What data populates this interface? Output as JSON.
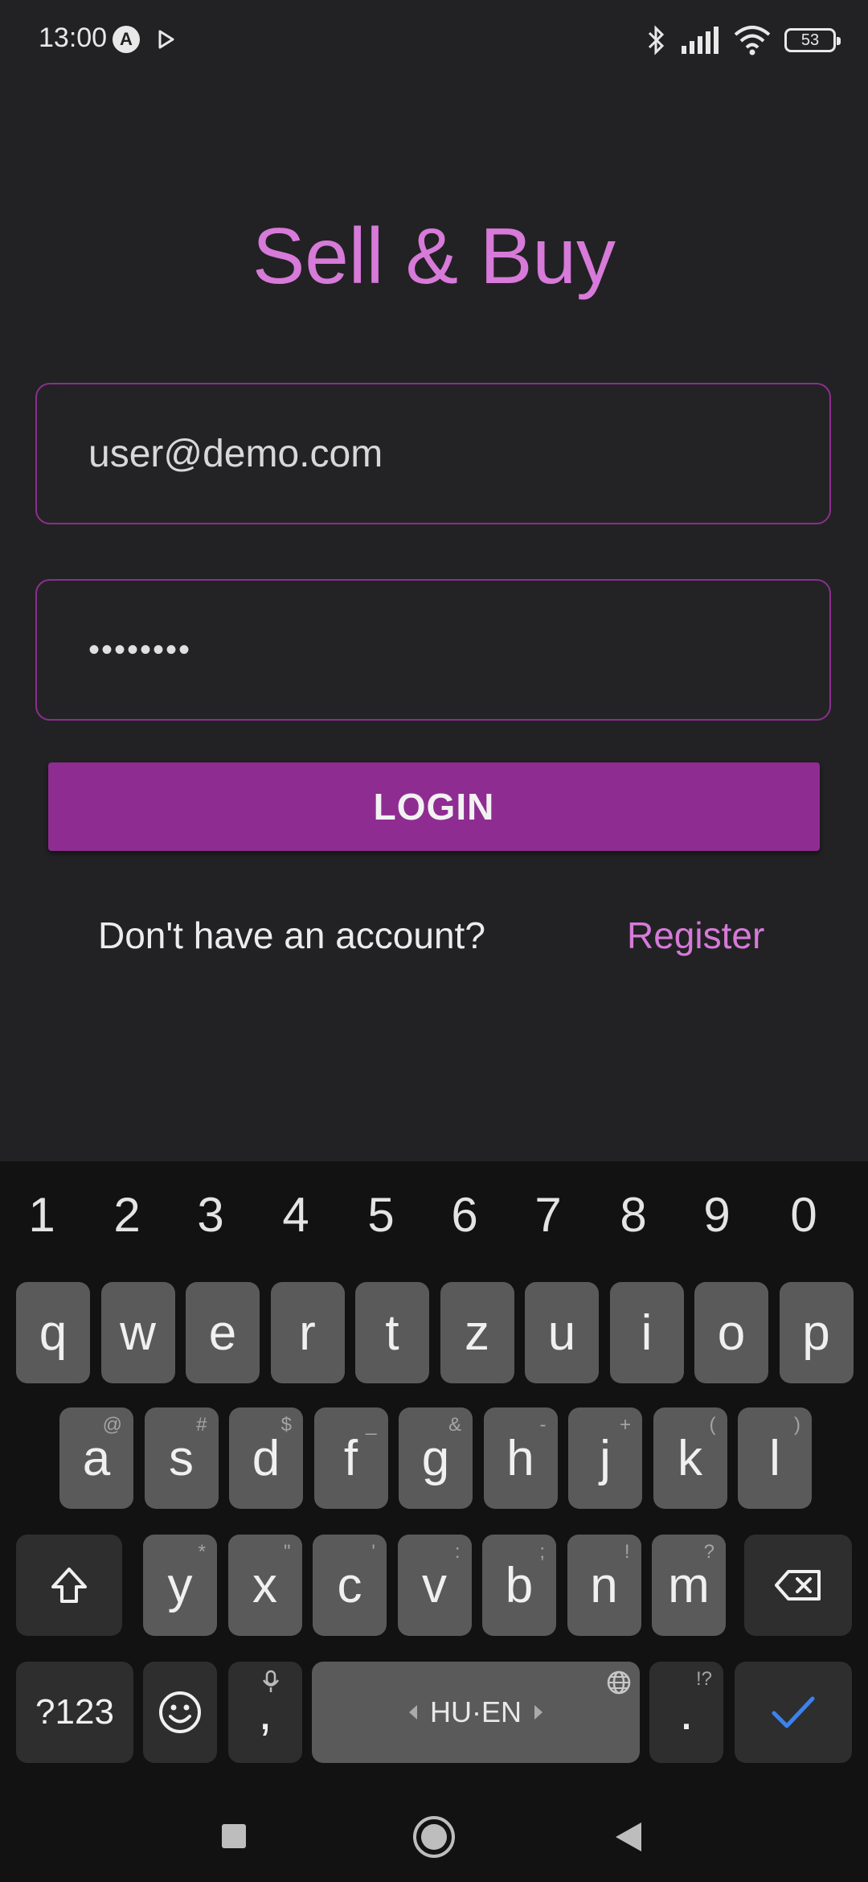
{
  "status_bar": {
    "time": "13:00",
    "battery": "53",
    "a_badge": "A"
  },
  "app": {
    "title": "Sell & Buy"
  },
  "form": {
    "email_value": "user@demo.com",
    "password_mask": "••••••••",
    "login_label": "LOGIN",
    "no_account_text": "Don't have an account?",
    "register_label": "Register"
  },
  "colors": {
    "accent": "#d77ad9",
    "button": "#8f2c91",
    "field_border": "#8b2f8e",
    "background": "#222224"
  },
  "keyboard": {
    "numbers": [
      "1",
      "2",
      "3",
      "4",
      "5",
      "6",
      "7",
      "8",
      "9",
      "0"
    ],
    "row1": [
      "q",
      "w",
      "e",
      "r",
      "t",
      "z",
      "u",
      "i",
      "o",
      "p"
    ],
    "row2": [
      "a",
      "s",
      "d",
      "f",
      "g",
      "h",
      "j",
      "k",
      "l"
    ],
    "row2_hints": [
      "@",
      "#",
      "$",
      "_",
      "&",
      "-",
      "+",
      "(",
      ")"
    ],
    "row3": [
      "y",
      "x",
      "c",
      "v",
      "b",
      "n",
      "m"
    ],
    "row3_hints": [
      "*",
      "\"",
      "'",
      ":",
      ";",
      "!",
      "?"
    ],
    "symbols_label": "?123",
    "comma": ",",
    "space_label": "HU·EN",
    "period": ".",
    "period_hint": "!?"
  },
  "icons": [
    "bluetooth-icon",
    "signal-icon",
    "wifi-icon",
    "battery-icon",
    "shift-icon",
    "backspace-icon",
    "emoji-icon",
    "mic-icon",
    "globe-icon",
    "checkmark-icon",
    "nav-recents-icon",
    "nav-home-icon",
    "nav-back-icon"
  ]
}
